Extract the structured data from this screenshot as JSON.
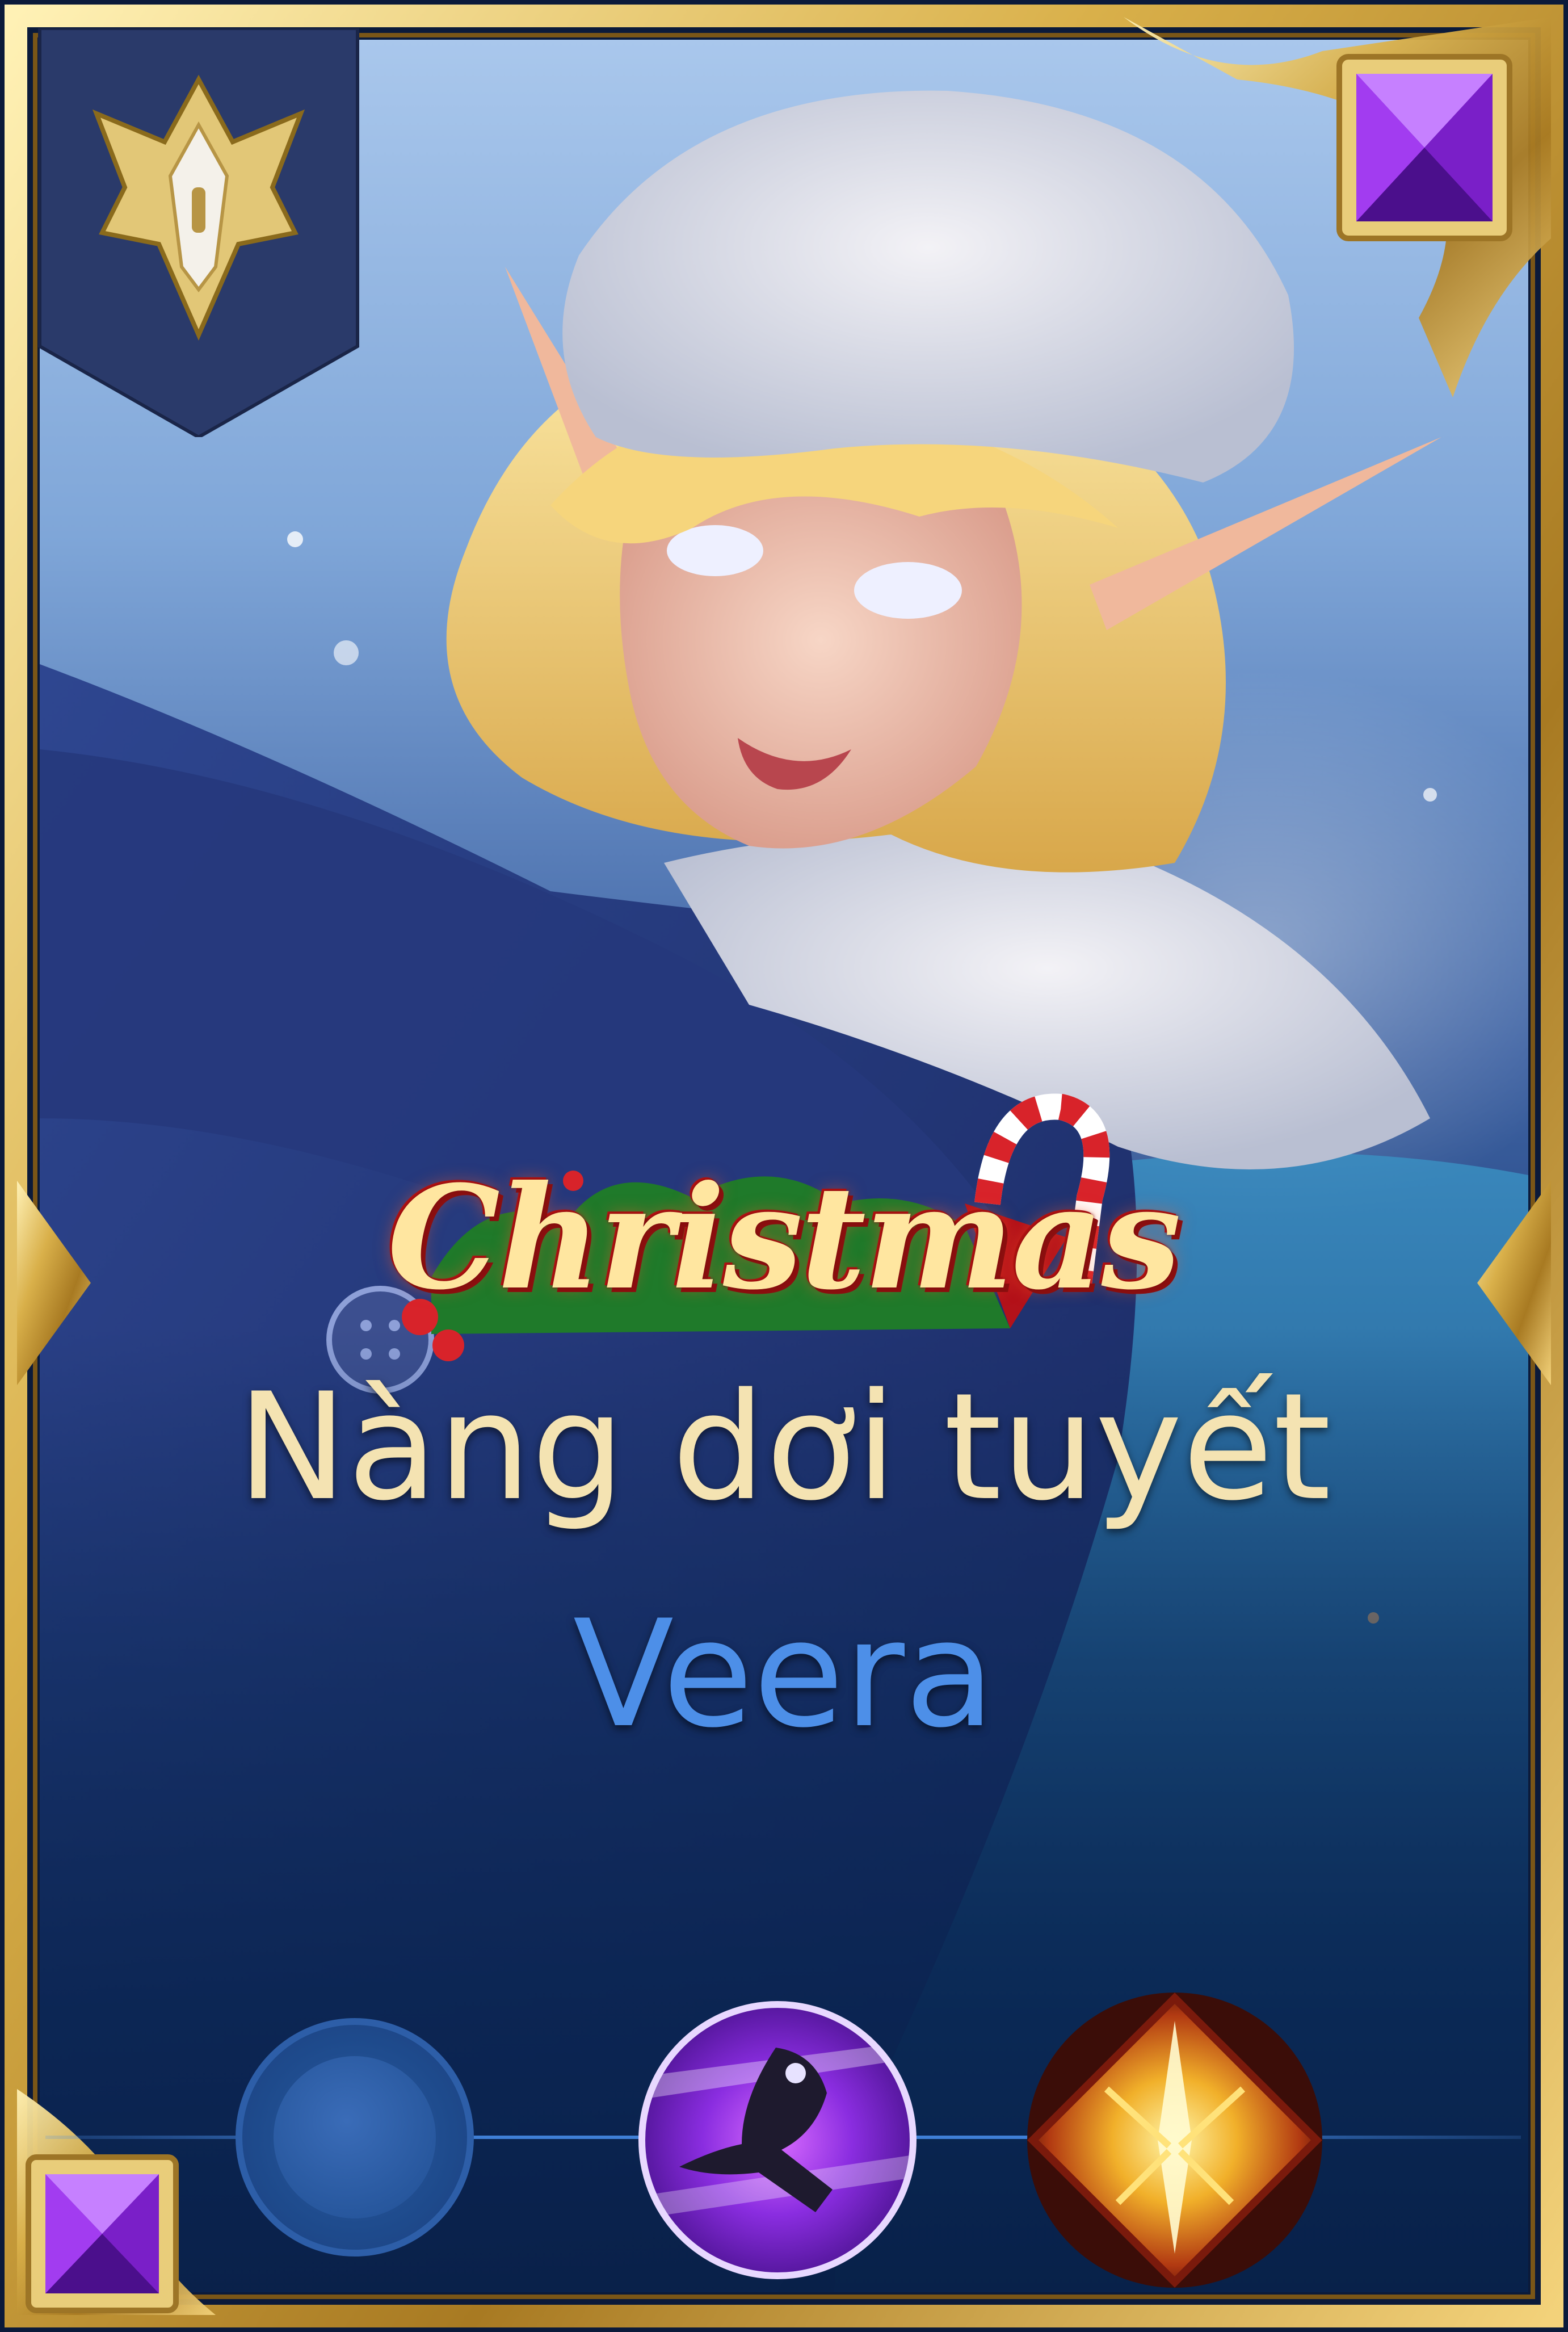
{
  "card": {
    "event_logo_text": "Christmas",
    "skin_name": "Nàng dơi tuyết",
    "hero_name": "Veera"
  },
  "icons": {
    "rank": "rank-emblem-icon",
    "top_gem": "purple-gem-icon",
    "bottom_gem": "purple-gem-icon",
    "skill_slot_1": "empty-slot-icon",
    "skill_slot_2": "hero-skill-icon",
    "skill_slot_3": "summoner-spell-icon"
  },
  "colors": {
    "frame_gold": "#d9b04a",
    "skin_name": "#f4e3b2",
    "hero_name": "#4d8fe8",
    "gem_purple": "#a23cf0",
    "rank_banner": "#2a3a6a"
  }
}
